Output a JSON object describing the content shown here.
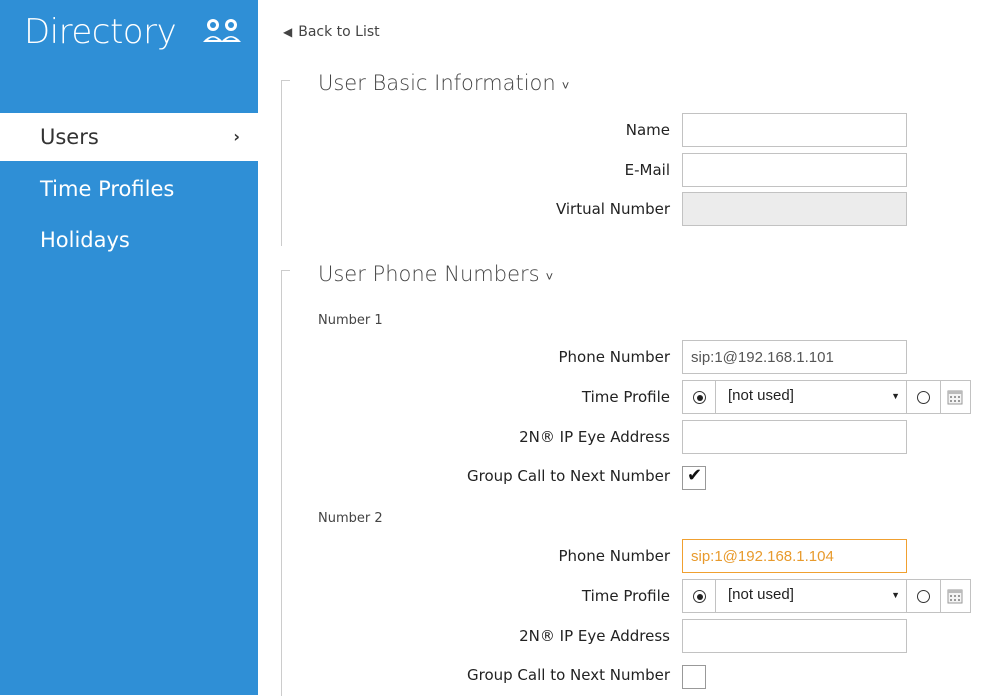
{
  "sidebar": {
    "title": "Directory",
    "title_icon": "users-icon",
    "items": [
      {
        "label": "Users",
        "active": true,
        "chevron": "›"
      },
      {
        "label": "Time Profiles",
        "active": false
      },
      {
        "label": "Holidays",
        "active": false
      }
    ],
    "bg_color": "#2f8fd6"
  },
  "main": {
    "back_link": "Back to List",
    "basic_info": {
      "title": "User Basic Information",
      "caret": "˅",
      "name_label": "Name",
      "name_value": "",
      "email_label": "E-Mail",
      "email_value": "",
      "virtual_label": "Virtual Number",
      "virtual_value": ""
    },
    "phone_numbers": {
      "title": "User Phone Numbers",
      "caret": "˅",
      "numbers": [
        {
          "heading": "Number 1",
          "phone_label": "Phone Number",
          "phone_value": "sip:1@192.168.1.101",
          "time_profile_label": "Time Profile",
          "time_profile_value": "[not used]",
          "eye_label": "2N® IP Eye Address",
          "eye_value": "",
          "group_call_label": "Group Call to Next Number",
          "group_call_checked": true
        },
        {
          "heading": "Number 2",
          "phone_label": "Phone Number",
          "phone_value": "sip:1@192.168.1.104",
          "time_profile_label": "Time Profile",
          "time_profile_value": "[not used]",
          "eye_label": "2N® IP Eye Address",
          "eye_value": "",
          "group_call_label": "Group Call to Next Number",
          "group_call_checked": false
        }
      ]
    },
    "focus_color": "#f0a030"
  }
}
